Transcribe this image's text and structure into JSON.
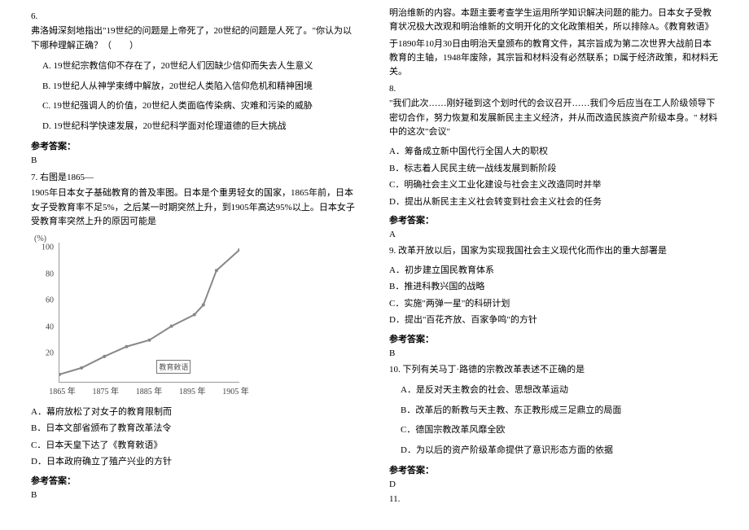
{
  "left": {
    "q6": {
      "num": "6.",
      "stem": "弗洛姆深刻地指出\"19世纪的问题是上帝死了，20世纪的问题是人死了。\"你认为以下哪种理解正确？（　　）",
      "A": "A. 19世纪宗教信仰不存在了，20世纪人们因缺少信仰而失去人生意义",
      "B": "B. 19世纪人从神学束缚中解放，20世纪人类陷入信仰危机和精神困境",
      "C": "C. 19世纪强调人的价值，20世纪人类面临传染病、灾难和污染的威胁",
      "D": "D. 19世纪科学快速发展，20世纪科学面对伦理道德的巨大挑战",
      "ans_label": "参考答案：",
      "ans": "B"
    },
    "q7": {
      "num_and_lead": "7. 右图是1865—",
      "stem": "1905年日本女子基础教育的普及率图。日本是个重男轻女的国家，1865年前，日本女子受教育率不足5%，之后某一时期突然上升，到1905年高达95%以上。日本女子受教育率突然上升的原因可能是",
      "A": "A．幕府放松了对女子的教育限制而",
      "B": "B．日本文部省颁布了教育改革法令",
      "C": "C．日本天皇下达了《教育敕语》",
      "D": "D．日本政府确立了殖产兴业的方针",
      "ans_label": "参考答案：",
      "ans": "B"
    },
    "chart": {
      "y_unit": "(%)",
      "y_ticks": [
        "100",
        "80",
        "60",
        "40",
        "20"
      ],
      "x_ticks": [
        "1865 年",
        "1875 年",
        "1885 年",
        "1895 年",
        "1905 年"
      ]
    }
  },
  "right": {
    "q7_explain": {
      "p1": "明治维新的内容。本题主要考查学生运用所学知识解决问题的能力。日本女子受教育状况极大改观和明治维新的文明开化的文化政策相关，所以排除A。《教育敕语》",
      "p2": "于1890年10月30日由明治天皇颁布的教育文件，其宗旨成为第二次世界大战前日本教育的主轴，1948年废除，其宗旨和材料没有必然联系；D属于经济政策，和材料无关。"
    },
    "q8": {
      "num": "8.",
      "stem": "\"我们此次……刚好碰到这个划时代的会议召开……我们今后应当在工人阶级领导下密切合作，努力恢复和发展新民主主义经济，并从而改造民族资产阶级本身。\" 材料中的这次\"会议\"",
      "A": "A．筹备成立新中国代行全国人大的职权",
      "B": "B．标志着人民民主统一战线发展到新阶段",
      "C": "C．明确社会主义工业化建设与社会主义改造同时并举",
      "D": "D．提出从新民主主义社会转变到社会主义社会的任务",
      "ans_label": "参考答案：",
      "ans": "A"
    },
    "q9": {
      "stem": "9. 改革开放以后，国家为实现我国社会主义现代化而作出的重大部署是",
      "A": "A．初步建立国民教育体系",
      "B": "B．推进科教兴国的战略",
      "C": "C．实施\"两弹一星\"的科研计划",
      "D": "D．提出\"百花齐放、百家争鸣\"的方针",
      "ans_label": "参考答案：",
      "ans": "B"
    },
    "q10": {
      "stem": "10. 下列有关马丁·路德的宗教改革表述不正确的是",
      "A": "A．是反对天主教会的社会、思想改革运动",
      "B": "B．改革后的新教与天主教、东正教形成三足鼎立的局面",
      "C": "C．德国宗教改革风靡全欧",
      "D": "D．为以后的资产阶级革命提供了意识形态方面的依据",
      "ans_label": "参考答案：",
      "ans": "D"
    },
    "q11": {
      "num": "11."
    }
  },
  "chart_data": {
    "type": "line",
    "title": "1865—1905年日本女子基础教育普及率",
    "xlabel": "年",
    "ylabel": "(%)",
    "ylim": [
      0,
      100
    ],
    "x": [
      1865,
      1870,
      1875,
      1880,
      1885,
      1890,
      1895,
      1897,
      1900,
      1905
    ],
    "values": [
      5,
      10,
      18,
      25,
      30,
      40,
      48,
      55,
      80,
      95
    ],
    "annotations": [
      "教育敕语"
    ]
  }
}
